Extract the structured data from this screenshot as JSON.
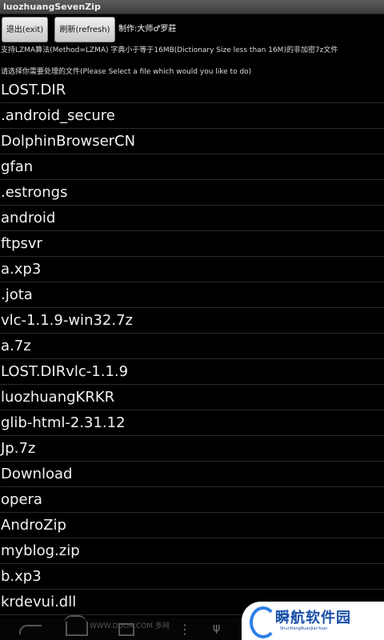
{
  "app": {
    "title": "luozhuangSevenZip"
  },
  "toolbar": {
    "exit_label": "退出(exit)",
    "refresh_label": "刷新(refresh)",
    "author": "制作:大师♂罗莊"
  },
  "info": {
    "line1": "支持LZMA算法(Method=LZMA) 字典小于等于16MB(Dictionary Size less than 16M)的非加密7z文件",
    "line2": "请选择你需要处理的文件(Please Select a file which would you like to do)"
  },
  "files": [
    "LOST.DIR",
    ".android_secure",
    "DolphinBrowserCN",
    "gfan",
    ".estrongs",
    "android",
    "ftpsvr",
    "a.xp3",
    ".jota",
    "vlc-1.1.9-win32.7z",
    "a.7z",
    "LOST.DIRvlc-1.1.9",
    "luozhuangKRKR",
    "glib-html-2.31.12",
    "Jp.7z",
    "Download",
    "opera",
    "AndroZip",
    "myblog.zip",
    "b.xp3",
    "krdevui.dll"
  ],
  "watermark": {
    "bottom_text": "WWW.DUOA.COM 多网",
    "logo_text": "瞬航软件园",
    "logo_sub": "ShunHangRuanJianYuan"
  },
  "icons": {
    "back": "back-arrow-icon",
    "home": "home-icon",
    "recent": "recent-apps-icon",
    "menu": "menu-dots-icon",
    "usb": "usb-icon"
  },
  "colors": {
    "background": "#000000",
    "text": "#ffffff",
    "button": "#dcdcdc",
    "logo_blue": "#1a4fa8"
  }
}
